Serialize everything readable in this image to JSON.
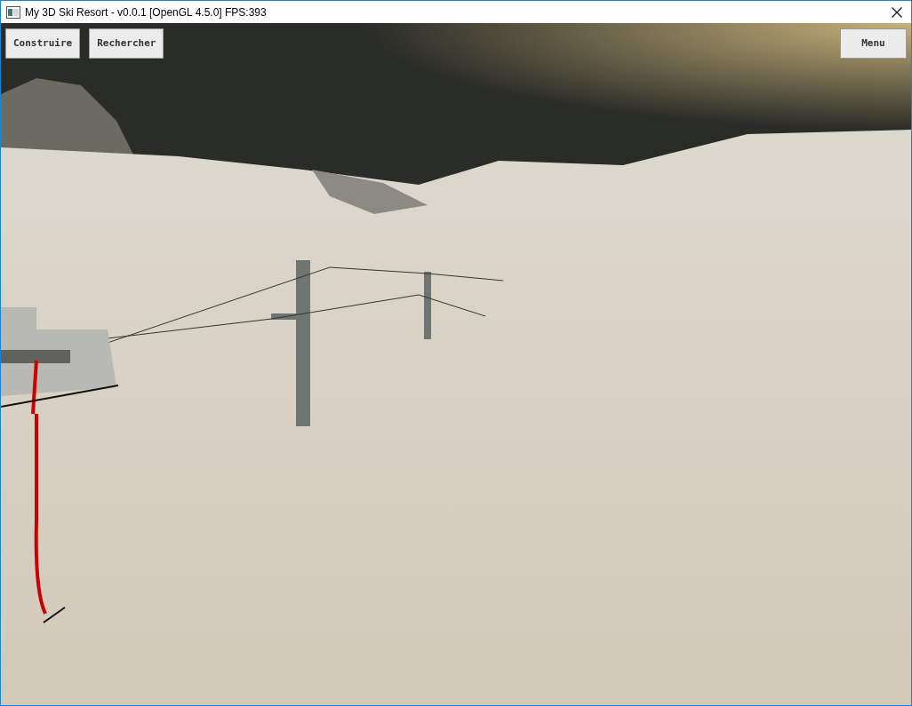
{
  "window": {
    "title": "My 3D Ski Resort - v0.0.1 [OpenGL 4.5.0] FPS:393"
  },
  "toolbar_left": [
    {
      "label": "Construire"
    },
    {
      "label": "Rechercher"
    }
  ],
  "toolbar_right": [
    {
      "label": "Menu"
    }
  ]
}
